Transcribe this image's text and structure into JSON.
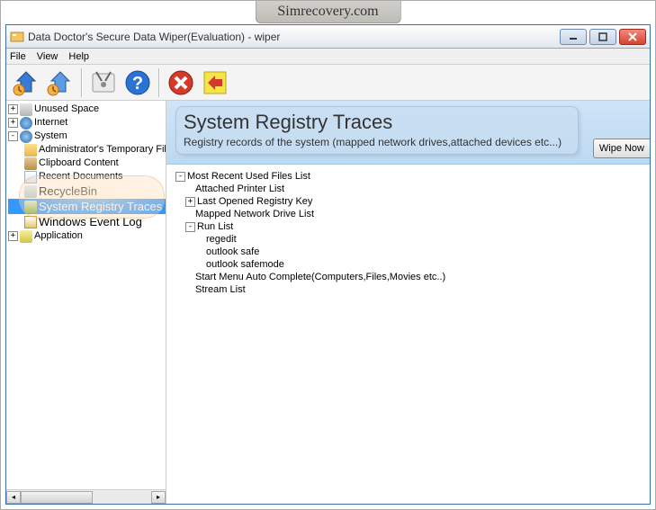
{
  "watermark": "Simrecovery.com",
  "window": {
    "title": "Data Doctor's Secure Data Wiper(Evaluation) - wiper"
  },
  "menu": {
    "file": "File",
    "view": "View",
    "help": "Help"
  },
  "header": {
    "title": "System Registry Traces",
    "subtitle": "Registry records of the system (mapped network drives,attached devices etc...)"
  },
  "buttons": {
    "wipe_now": "Wipe Now"
  },
  "sidebar": {
    "unused_space": "Unused Space",
    "internet": "Internet",
    "system": "System",
    "admin_temp": "Administrator's Temporary Files",
    "clipboard": "Clipboard Content",
    "recent_docs": "Recent Documents",
    "recycle_bin": "RecycleBin",
    "registry_traces": "System Registry Traces",
    "event_log": "Windows Event Log",
    "application": "Application"
  },
  "detail_tree": {
    "mru": "Most Recent Used Files List",
    "printer": "Attached Printer List",
    "last_reg": "Last Opened Registry Key",
    "mapped_drive": "Mapped Network Drive List",
    "run_list": "Run List",
    "regedit": "regedit",
    "outlook_safe": "outlook safe",
    "outlook_safemode": "outlook safemode",
    "start_menu": "Start Menu Auto Complete(Computers,Files,Movies etc..)",
    "stream_list": "Stream List"
  }
}
